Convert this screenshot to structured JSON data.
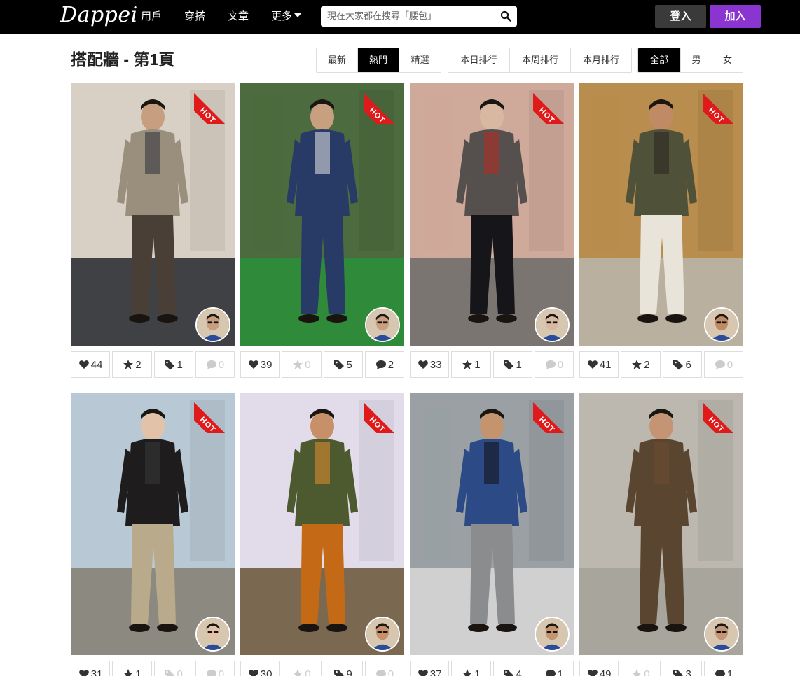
{
  "nav": {
    "logo": "Dappei",
    "links": [
      "用戶",
      "穿搭",
      "文章",
      "更多"
    ],
    "search_placeholder": "現在大家都在搜尋「腰包」",
    "login": "登入",
    "join": "加入"
  },
  "page": {
    "title": "搭配牆 - 第1頁",
    "sort_tabs": [
      "最新",
      "熱門",
      "精選"
    ],
    "rank_tabs": [
      "本日排行",
      "本周排行",
      "本月排行"
    ],
    "gender_tabs": [
      "全部",
      "男",
      "女"
    ]
  },
  "colors": {
    "brand_purple": "#8a35d0",
    "hot_red": "#e01a1a",
    "navbar": "#000000"
  },
  "hot_label": "HOT",
  "posts": [
    {
      "likes": "44",
      "stars": "2",
      "tags": "1",
      "comments": "0"
    },
    {
      "likes": "39",
      "stars": "0",
      "tags": "5",
      "comments": "2"
    },
    {
      "likes": "33",
      "stars": "1",
      "tags": "1",
      "comments": "0"
    },
    {
      "likes": "41",
      "stars": "2",
      "tags": "6",
      "comments": "0"
    },
    {
      "likes": "31",
      "stars": "1",
      "tags": "0",
      "comments": "0"
    },
    {
      "likes": "30",
      "stars": "0",
      "tags": "9",
      "comments": "0"
    },
    {
      "likes": "37",
      "stars": "1",
      "tags": "4",
      "comments": "1"
    },
    {
      "likes": "49",
      "stars": "0",
      "tags": "3",
      "comments": "1"
    }
  ]
}
